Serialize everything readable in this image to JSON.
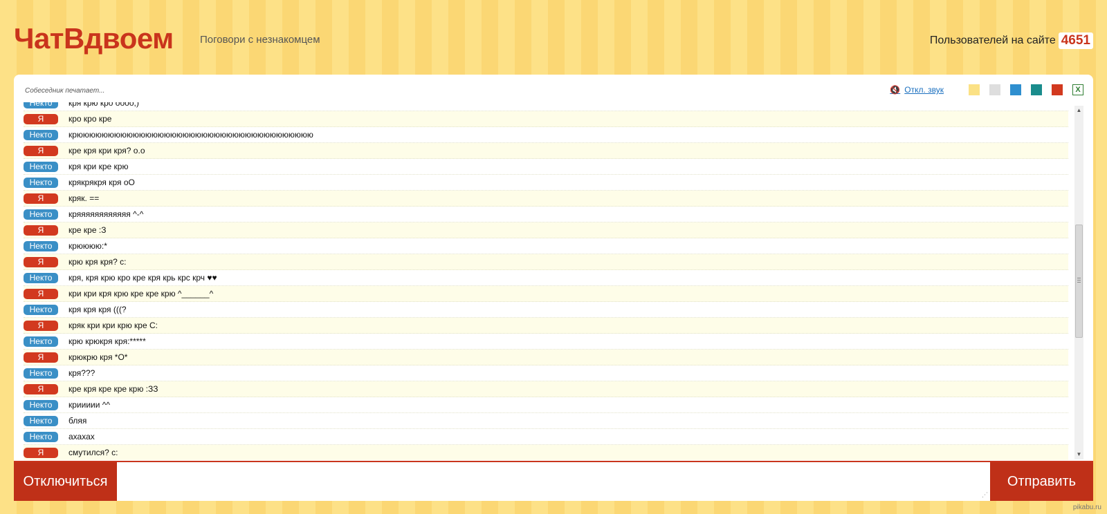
{
  "header": {
    "logo": "ЧатВдвоем",
    "tagline": "Поговори с незнакомцем",
    "online_label": "Пользователей на сайте",
    "online_count": "4651"
  },
  "status": {
    "typing": "Собеседник печатает...",
    "sound_label": "Откл. звук",
    "sound_icon": "speaker-muted-icon",
    "export_icon": "excel-icon"
  },
  "themes": [
    {
      "name": "yellow",
      "color": "#fbe185"
    },
    {
      "name": "gray",
      "color": "#dedede"
    },
    {
      "name": "blue",
      "color": "#2f8fcf"
    },
    {
      "name": "teal",
      "color": "#1a8c8c"
    },
    {
      "name": "red",
      "color": "#d2391f"
    }
  ],
  "labels": {
    "me": "Я",
    "other": "Некто"
  },
  "colors": {
    "me": "#d2391f",
    "other": "#3a8fc6",
    "accent": "#c9341c"
  },
  "messages": [
    {
      "from": "other",
      "text": "кря крю кро оооо;)"
    },
    {
      "from": "me",
      "text": "кро кро кре"
    },
    {
      "from": "other",
      "text": "крюююююююююююююююююююююююююююююююююююююю"
    },
    {
      "from": "me",
      "text": "кре кря кри кря? о.о"
    },
    {
      "from": "other",
      "text": "кря кри кре крю"
    },
    {
      "from": "other",
      "text": "крякрякря кря оО"
    },
    {
      "from": "me",
      "text": "кряк. =="
    },
    {
      "from": "other",
      "text": "кряяяяяяяяяяяя ^-^"
    },
    {
      "from": "me",
      "text": "кре кре :З"
    },
    {
      "from": "other",
      "text": "крюююю:*"
    },
    {
      "from": "me",
      "text": "крю кря кря? с:"
    },
    {
      "from": "other",
      "text": "кря, кря крю кро кре кря крь крс крч ♥♥"
    },
    {
      "from": "me",
      "text": "кри кри кря крю кре кре крю ^______^"
    },
    {
      "from": "other",
      "text": "кря кря кря (((?"
    },
    {
      "from": "me",
      "text": "кряк кри кри крю кре С:"
    },
    {
      "from": "other",
      "text": "крю крюкря кря:*****"
    },
    {
      "from": "me",
      "text": "крюкрю кря *О*"
    },
    {
      "from": "other",
      "text": "кря???"
    },
    {
      "from": "me",
      "text": "кре кря кре кре крю :ЗЗ"
    },
    {
      "from": "other",
      "text": "криииии ^^"
    },
    {
      "from": "other",
      "text": "бляя"
    },
    {
      "from": "other",
      "text": "ахахах"
    },
    {
      "from": "me",
      "text": "смутился? с:"
    }
  ],
  "controls": {
    "disconnect": "Отключиться",
    "send": "Отправить",
    "input_value": ""
  },
  "watermark": "pikabu.ru"
}
